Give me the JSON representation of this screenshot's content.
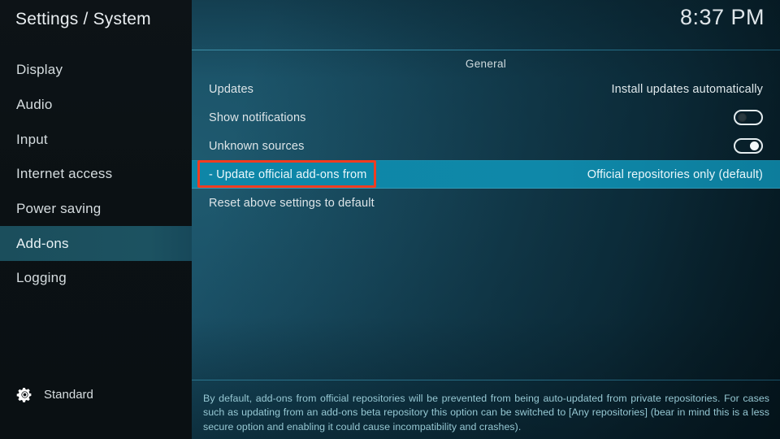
{
  "header": {
    "title": "Settings / System",
    "clock": "8:37 PM"
  },
  "sidebar": {
    "items": [
      {
        "label": "Display",
        "selected": false
      },
      {
        "label": "Audio",
        "selected": false
      },
      {
        "label": "Input",
        "selected": false
      },
      {
        "label": "Internet access",
        "selected": false
      },
      {
        "label": "Power saving",
        "selected": false
      },
      {
        "label": "Add-ons",
        "selected": true
      },
      {
        "label": "Logging",
        "selected": false
      }
    ],
    "level": {
      "icon": "gear-icon",
      "label": "Standard"
    }
  },
  "main": {
    "group_title": "General",
    "rows": [
      {
        "label": "Updates",
        "control": "value",
        "value": "Install updates automatically",
        "selected": false
      },
      {
        "label": "Show notifications",
        "control": "toggle",
        "toggle_state": "off",
        "selected": false
      },
      {
        "label": "Unknown sources",
        "control": "toggle",
        "toggle_state": "on",
        "selected": false
      },
      {
        "label": "- Update official add-ons from",
        "control": "value",
        "value": "Official repositories only (default)",
        "selected": true
      },
      {
        "label": "Reset above settings to default",
        "control": "none",
        "value": "",
        "selected": false
      }
    ],
    "description": "By default, add-ons from official repositories will be prevented from being auto-updated from private repositories. For cases such as updating from an add-ons beta repository this option can be switched to [Any repositories] (bear in mind this is a less secure option and enabling it could cause incompatibility and crashes)."
  },
  "annotation": {
    "type": "highlight-rectangle",
    "color": "#f03c20",
    "target": "- Update official add-ons from"
  },
  "colors": {
    "selection_row": "#0f87a8",
    "sidebar_selection": "#1b4e5c",
    "background_teal": "#1a5066",
    "sidebar_background": "#0b1114",
    "description_text": "#96c8d3",
    "annotation_red": "#f03c20"
  }
}
